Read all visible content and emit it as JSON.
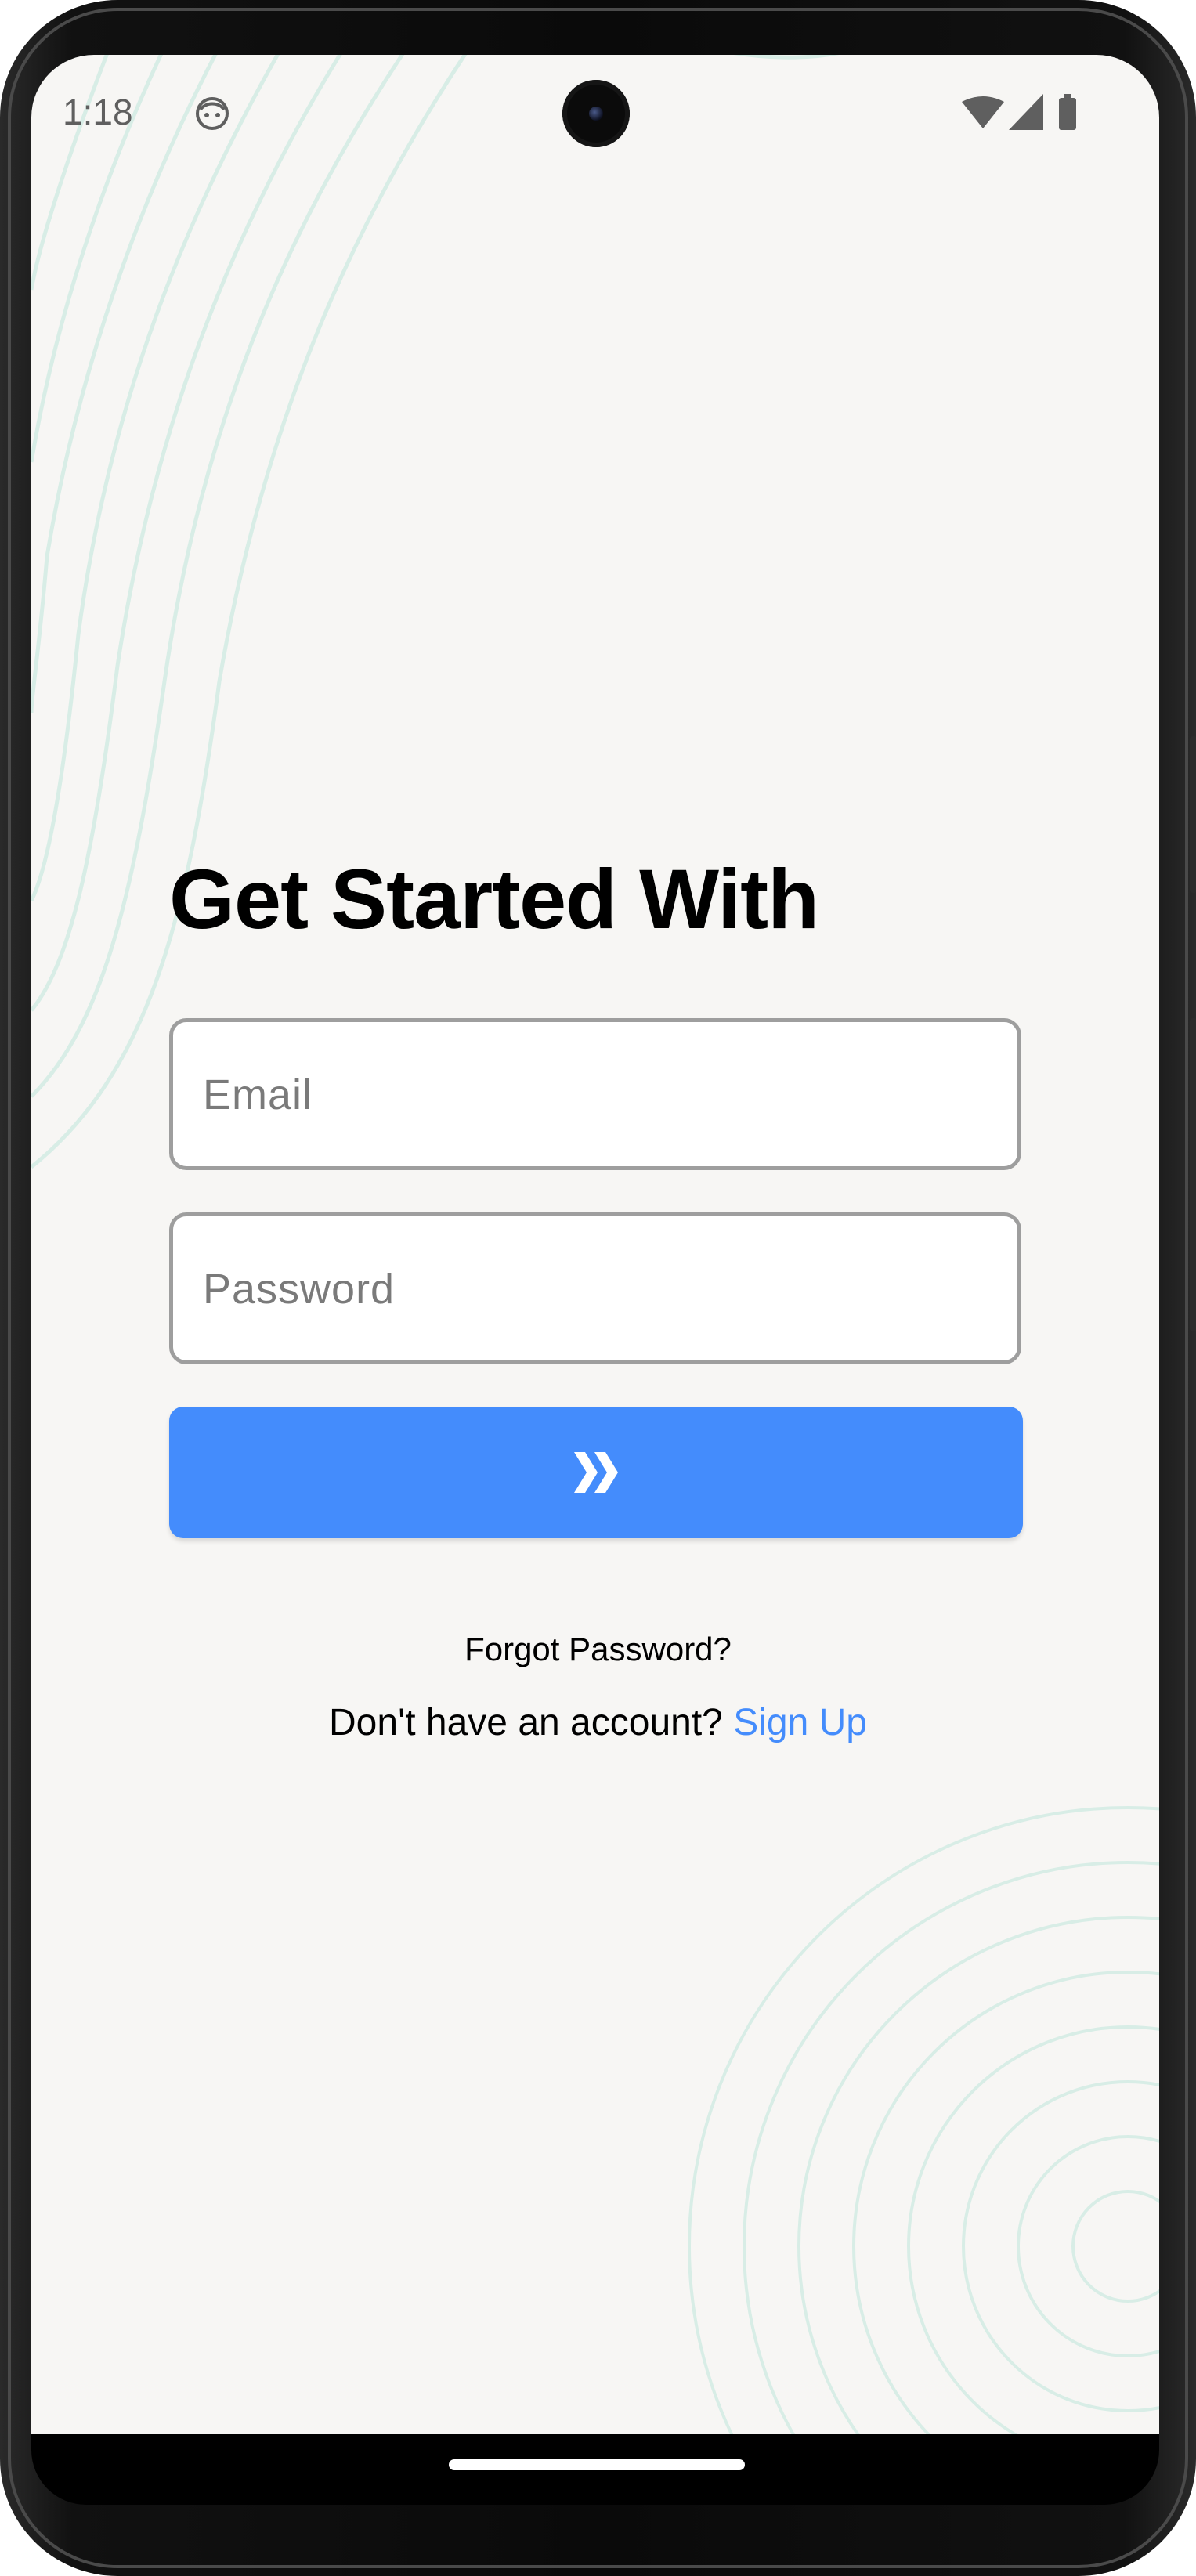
{
  "status_bar": {
    "time": "1:18",
    "notification_icon": "face-icon",
    "right_icons": [
      "wifi-icon",
      "signal-icon",
      "battery-icon"
    ]
  },
  "login": {
    "title": "Get Started With",
    "email_placeholder": "Email",
    "email_value": "",
    "password_placeholder": "Password",
    "password_value": "",
    "submit_icon": "double-chevron-right-icon",
    "forgot_password": "Forgot Password?",
    "signup_prompt": "Don't have an account?",
    "signup_link": "Sign Up"
  },
  "colors": {
    "background": "#f7f6f4",
    "accent": "#448cfc",
    "field_border": "#9e9e9e",
    "decoration_lines": "#d8ede6"
  }
}
